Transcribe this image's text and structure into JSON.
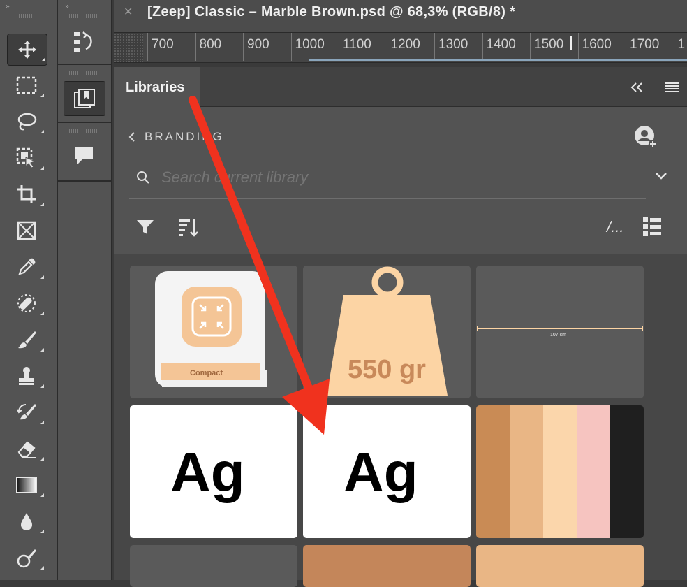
{
  "document": {
    "title": "[Zeep] Classic – Marble Brown.psd @ 68,3% (RGB/8) *",
    "close_icon": "close-icon"
  },
  "ruler": {
    "ticks": [
      "700",
      "800",
      "900",
      "1000",
      "1100",
      "1200",
      "1300",
      "1400",
      "1500",
      "1600",
      "1700",
      "1"
    ]
  },
  "toolbar": {
    "tools": [
      "move-tool",
      "rectangular-marquee-tool",
      "lasso-tool",
      "object-selection-tool",
      "crop-tool",
      "frame-tool",
      "eyedropper-tool",
      "spot-healing-brush-tool",
      "brush-tool",
      "clone-stamp-tool",
      "history-brush-tool",
      "eraser-tool",
      "gradient-tool",
      "blur-tool",
      "dodge-tool"
    ]
  },
  "panels": {
    "buttons": [
      "history-panel",
      "libraries-panel",
      "comments-panel"
    ]
  },
  "libraries": {
    "tab_label": "Libraries",
    "breadcrumb_label": "BRANDING",
    "search_placeholder": "Search current library",
    "view_toggle": "/...",
    "tiles": {
      "compact_label": "Compact",
      "weight_label": "550 gr",
      "measure_label": "107 cm",
      "char_style_1": "Ag",
      "char_style_2": "Ag"
    },
    "colors": {
      "weight_fill": "#fcd4a4",
      "weight_text": "#c8895a",
      "compact_fill": "#f4c596",
      "brown": "#c4865a",
      "swatches": [
        "#c98b55",
        "#e9b685",
        "#fbd6ab",
        "#f6c4c0",
        "#1f1f1f"
      ],
      "bottom_tiles": [
        "#c4865a",
        "#e9b685"
      ]
    }
  },
  "annotation": {
    "arrow_color": "#f0321e"
  }
}
